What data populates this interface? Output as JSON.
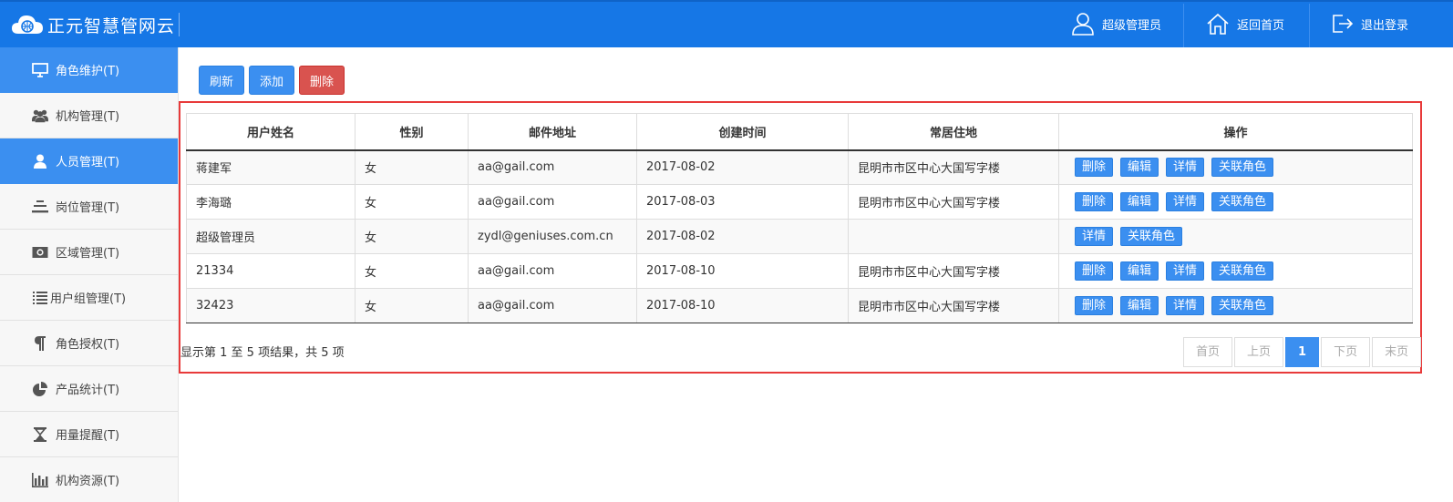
{
  "header": {
    "brand": "正元智慧管网云",
    "user_label": "超级管理员",
    "home_label": "返回首页",
    "logout_label": "退出登录"
  },
  "sidebar": {
    "items": [
      {
        "label": "角色维护(T)",
        "icon": "monitor-icon",
        "active": true
      },
      {
        "label": "机构管理(T)",
        "icon": "users-icon",
        "active": false
      },
      {
        "label": "人员管理(T)",
        "icon": "user-icon",
        "active": true
      },
      {
        "label": "岗位管理(T)",
        "icon": "lines-icon",
        "active": false
      },
      {
        "label": "区域管理(T)",
        "icon": "camera-icon",
        "active": false
      },
      {
        "label": "用户组管理(T)",
        "icon": "list-icon",
        "active": false
      },
      {
        "label": "角色授权(T)",
        "icon": "pilcrow-icon",
        "active": false
      },
      {
        "label": "产品统计(T)",
        "icon": "pie-chart-icon",
        "active": false
      },
      {
        "label": "用量提醒(T)",
        "icon": "hourglass-icon",
        "active": false
      },
      {
        "label": "机构资源(T)",
        "icon": "bar-chart-icon",
        "active": false
      }
    ]
  },
  "toolbar": {
    "refresh_label": "刷新",
    "add_label": "添加",
    "delete_label": "删除"
  },
  "table": {
    "columns": [
      "用户姓名",
      "性别",
      "邮件地址",
      "创建时间",
      "常居住地",
      "操作"
    ],
    "rows": [
      {
        "name": "蒋建军",
        "gender": "女",
        "email": "aa@gail.com",
        "created": "2017-08-02",
        "address": "昆明市市区中心大国写字楼",
        "actions": [
          "删除",
          "编辑",
          "详情",
          "关联角色"
        ]
      },
      {
        "name": "李海璐",
        "gender": "女",
        "email": "aa@gail.com",
        "created": "2017-08-03",
        "address": "昆明市市区中心大国写字楼",
        "actions": [
          "删除",
          "编辑",
          "详情",
          "关联角色"
        ]
      },
      {
        "name": "超级管理员",
        "gender": "女",
        "email": "zydl@geniuses.com.cn",
        "created": "2017-08-02",
        "address": "",
        "actions": [
          "详情",
          "关联角色"
        ]
      },
      {
        "name": "21334",
        "gender": "女",
        "email": "aa@gail.com",
        "created": "2017-08-10",
        "address": "昆明市市区中心大国写字楼",
        "actions": [
          "删除",
          "编辑",
          "详情",
          "关联角色"
        ]
      },
      {
        "name": "32423",
        "gender": "女",
        "email": "aa@gail.com",
        "created": "2017-08-10",
        "address": "昆明市市区中心大国写字楼",
        "actions": [
          "删除",
          "编辑",
          "详情",
          "关联角色"
        ]
      }
    ]
  },
  "pagination": {
    "info": "显示第 1 至 5 项结果，共 5 项",
    "first": "首页",
    "prev": "上页",
    "current": "1",
    "next": "下页",
    "last": "末页"
  },
  "colors": {
    "header": "#1677e6",
    "accent": "#3b8ff0",
    "danger": "#d9534f",
    "highlight_border": "#e83a3a"
  }
}
